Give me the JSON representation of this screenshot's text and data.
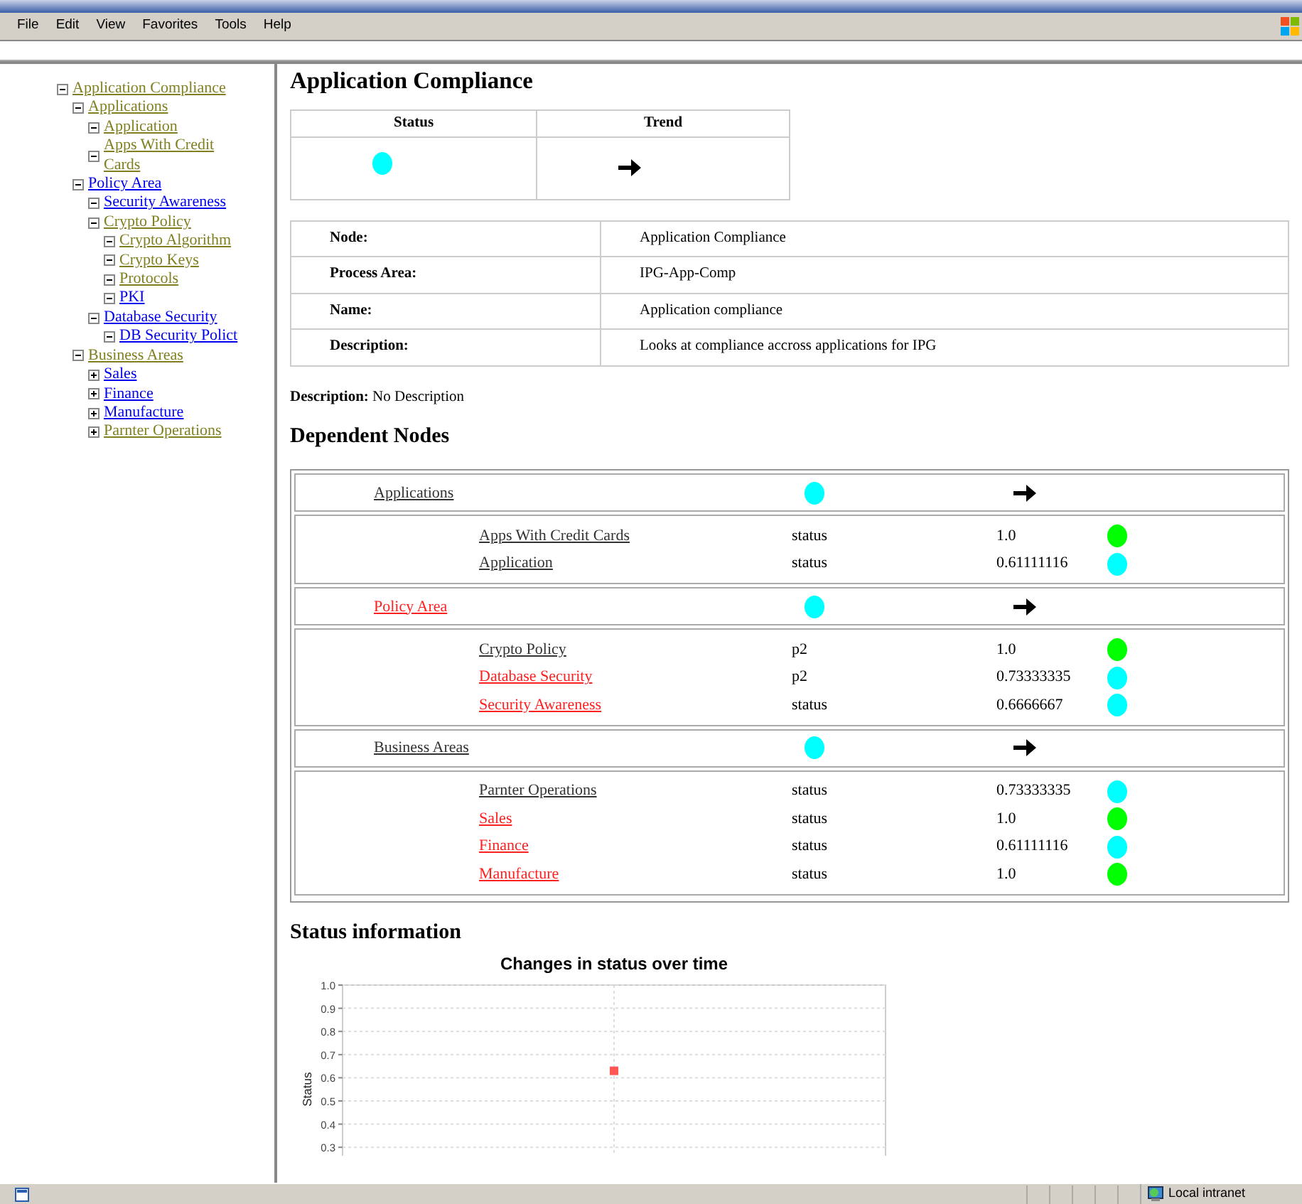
{
  "menu": [
    "File",
    "Edit",
    "View",
    "Favorites",
    "Tools",
    "Help"
  ],
  "tree": [
    {
      "label": "Application Compliance",
      "visited": true,
      "expanded": true,
      "children": [
        {
          "label": "Applications",
          "visited": true,
          "expanded": true,
          "children": [
            {
              "label": "Application",
              "visited": true,
              "expanded": true
            },
            {
              "label": "Apps With Credit Cards",
              "visited": true,
              "expanded": true
            }
          ]
        },
        {
          "label": "Policy Area",
          "visited": false,
          "expanded": true,
          "children": [
            {
              "label": "Security Awareness",
              "visited": false,
              "expanded": true
            },
            {
              "label": "Crypto Policy",
              "visited": true,
              "expanded": true,
              "children": [
                {
                  "label": "Crypto Algorithm",
                  "visited": true,
                  "expanded": true
                },
                {
                  "label": "Crypto Keys",
                  "visited": true,
                  "expanded": true
                },
                {
                  "label": "Protocols",
                  "visited": true,
                  "expanded": true
                },
                {
                  "label": "PKI",
                  "visited": false,
                  "expanded": true
                }
              ]
            },
            {
              "label": "Database Security",
              "visited": false,
              "expanded": true,
              "children": [
                {
                  "label": "DB Security Polict",
                  "visited": false,
                  "expanded": true
                }
              ]
            }
          ]
        },
        {
          "label": "Business Areas",
          "visited": true,
          "expanded": true,
          "children": [
            {
              "label": "Sales",
              "visited": false,
              "expanded": false
            },
            {
              "label": "Finance",
              "visited": false,
              "expanded": false
            },
            {
              "label": "Manufacture",
              "visited": false,
              "expanded": false
            },
            {
              "label": "Parnter Operations",
              "visited": true,
              "expanded": false
            }
          ]
        }
      ]
    }
  ],
  "title": "Application Compliance",
  "summary": {
    "columns": [
      "Status",
      "Trend"
    ],
    "color": "#00ffff"
  },
  "details": [
    {
      "label": "Node:",
      "value": "Application Compliance"
    },
    {
      "label": "Process Area:",
      "value": "IPG-App-Comp"
    },
    {
      "label": "Name:",
      "value": "Application compliance"
    },
    {
      "label": "Description:",
      "value": "Looks at compliance accross applications for IPG"
    }
  ],
  "description": {
    "label": "Description:",
    "value": "No Description"
  },
  "dependent_heading": "Dependent Nodes",
  "groups": [
    {
      "name": "Applications",
      "flagged": false,
      "color": "#00ffff",
      "children": [
        {
          "name": "Apps With Credit Cards",
          "flagged": false,
          "metric": "status",
          "value": "1.0",
          "color": "#00ff00"
        },
        {
          "name": "Application",
          "flagged": false,
          "metric": "status",
          "value": "0.61111116",
          "color": "#00ffff"
        }
      ]
    },
    {
      "name": "Policy Area",
      "flagged": true,
      "color": "#00ffff",
      "children": [
        {
          "name": "Crypto Policy",
          "flagged": false,
          "metric": "p2",
          "value": "1.0",
          "color": "#00ff00"
        },
        {
          "name": "Database Security",
          "flagged": true,
          "metric": "p2",
          "value": "0.73333335",
          "color": "#00ffff"
        },
        {
          "name": "Security Awareness",
          "flagged": true,
          "metric": "status",
          "value": "0.6666667",
          "color": "#00ffff"
        }
      ]
    },
    {
      "name": "Business Areas",
      "flagged": false,
      "color": "#00ffff",
      "children": [
        {
          "name": "Parnter Operations",
          "flagged": false,
          "metric": "status",
          "value": "0.73333335",
          "color": "#00ffff"
        },
        {
          "name": "Sales",
          "flagged": true,
          "metric": "status",
          "value": "1.0",
          "color": "#00ff00"
        },
        {
          "name": "Finance",
          "flagged": true,
          "metric": "status",
          "value": "0.61111116",
          "color": "#00ffff"
        },
        {
          "name": "Manufacture",
          "flagged": true,
          "metric": "status",
          "value": "1.0",
          "color": "#00ff00"
        }
      ]
    }
  ],
  "status_heading": "Status information",
  "chart_data": {
    "type": "scatter",
    "title": "Changes in status over time",
    "ylabel": "Status",
    "ylim": [
      0.3,
      1.0
    ],
    "yticks": [
      0.3,
      0.4,
      0.5,
      0.6,
      0.7,
      0.8,
      0.9,
      {
        "value": 1.0,
        "label": "1.0"
      }
    ],
    "grid": true,
    "series": [
      {
        "color": "#ff5555",
        "values": [
          0.63
        ]
      }
    ]
  },
  "status_bar": {
    "zone": "Local intranet"
  }
}
